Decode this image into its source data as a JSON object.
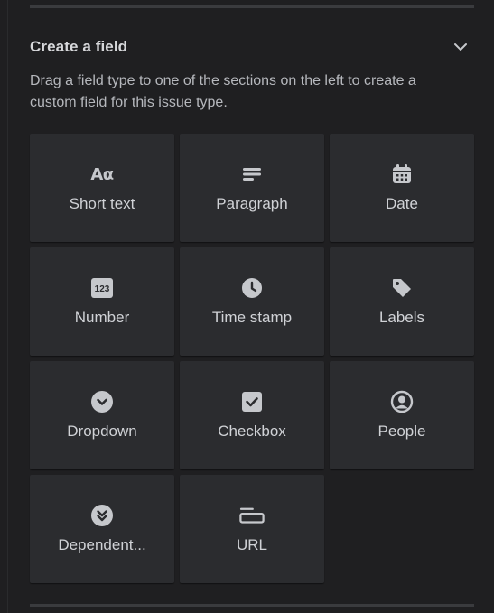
{
  "section": {
    "title": "Create a field",
    "description": "Drag a field type to one of the sections on the left to create a custom field for this issue type."
  },
  "field_types": [
    {
      "label": "Short text",
      "icon": "text-format-icon"
    },
    {
      "label": "Paragraph",
      "icon": "paragraph-icon"
    },
    {
      "label": "Date",
      "icon": "calendar-icon"
    },
    {
      "label": "Number",
      "icon": "number-icon"
    },
    {
      "label": "Time stamp",
      "icon": "clock-icon"
    },
    {
      "label": "Labels",
      "icon": "tag-icon"
    },
    {
      "label": "Dropdown",
      "icon": "chevron-circle-icon"
    },
    {
      "label": "Checkbox",
      "icon": "checkbox-icon"
    },
    {
      "label": "People",
      "icon": "person-circle-icon"
    },
    {
      "label": "Dependent...",
      "icon": "double-chevron-circle-icon"
    },
    {
      "label": "URL",
      "icon": "url-field-icon"
    }
  ],
  "icon_glyphs": {
    "short_text": "Aα",
    "number": "123"
  },
  "colors": {
    "background": "#1f1f21",
    "tile": "#2b2c2f",
    "text": "#d0d2d6",
    "icon": "#c6c8cc"
  }
}
